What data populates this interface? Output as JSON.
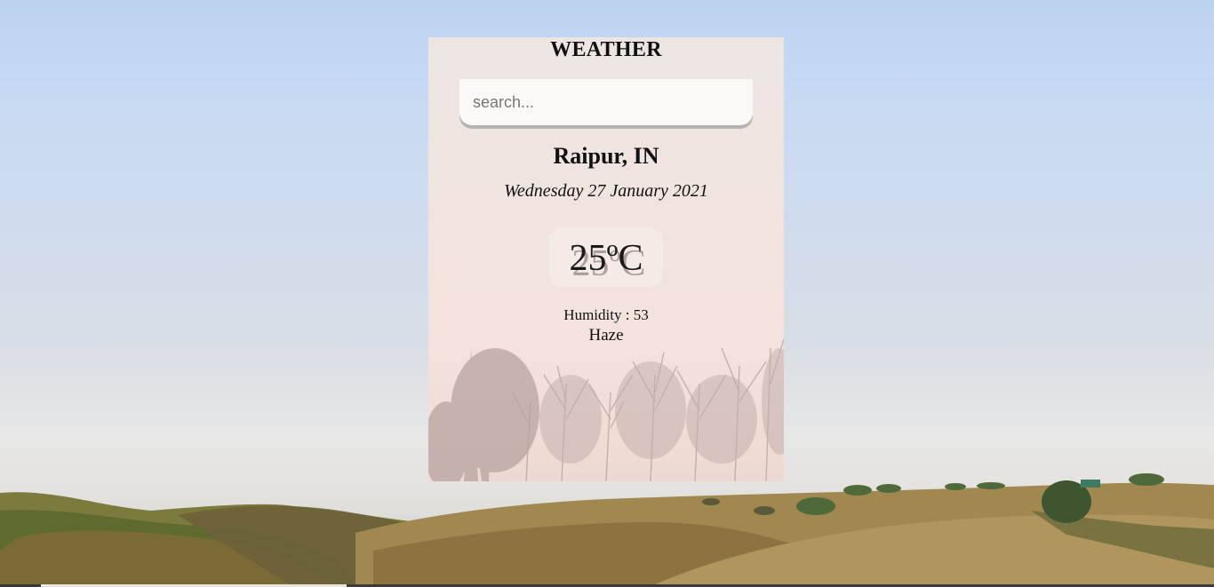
{
  "app": {
    "title": "WEATHER"
  },
  "search": {
    "value": "",
    "placeholder": "search..."
  },
  "weather": {
    "location": "Raipur, IN",
    "date": "Wednesday 27 January 2021",
    "temperature": "25ºC",
    "humidity": "Humidity : 53",
    "condition": "Haze"
  },
  "colors": {
    "sky_top": "#bcd3f0",
    "card_background": "#f1e3de",
    "text": "#111111",
    "hills": "#8a7a45"
  },
  "icons": {
    "background": "mountain-landscape",
    "card_background": "misty-trees"
  }
}
